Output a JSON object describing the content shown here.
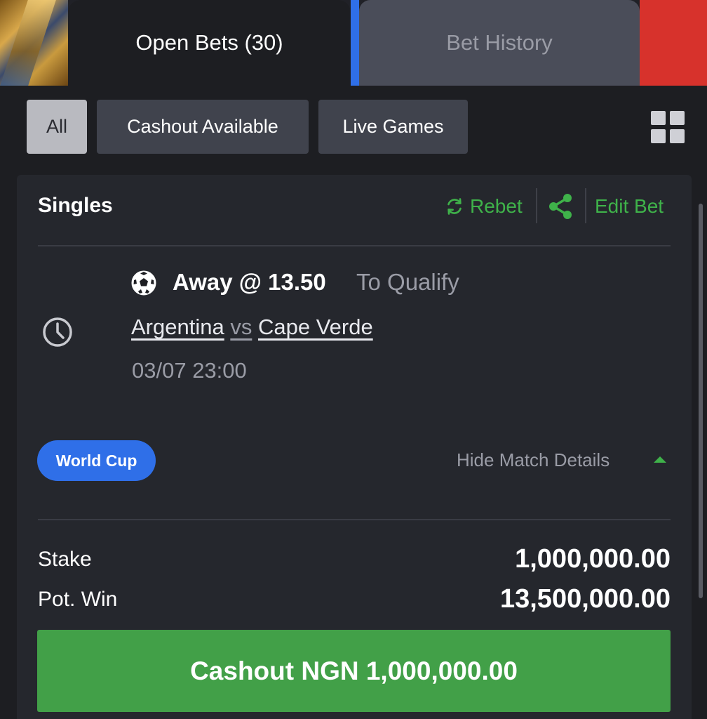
{
  "tabs": {
    "open_bets": "Open Bets (30)",
    "bet_history": "Bet History"
  },
  "filters": [
    {
      "label": "All",
      "active": true
    },
    {
      "label": "Cashout Available",
      "active": false
    },
    {
      "label": "Live Games",
      "active": false
    }
  ],
  "bet": {
    "type": "Singles",
    "rebet_label": "Rebet",
    "edit_label": "Edit Bet",
    "selection": "Away @ 13.50",
    "market": "To Qualify",
    "home_team": "Argentina",
    "vs": "vs",
    "away_team": "Cape Verde",
    "datetime": "03/07 23:00",
    "competition": "World Cup",
    "hide_details_label": "Hide Match Details",
    "stake_label": "Stake",
    "stake_value": "1,000,000.00",
    "potwin_label": "Pot. Win",
    "potwin_value": "13,500,000.00",
    "cashout_label": "Cashout NGN 1,000,000.00"
  },
  "colors": {
    "accent_green": "#3fb24a",
    "cashout_green": "#42a048",
    "badge_blue": "#2f6fe8",
    "background": "#1d1e22"
  }
}
